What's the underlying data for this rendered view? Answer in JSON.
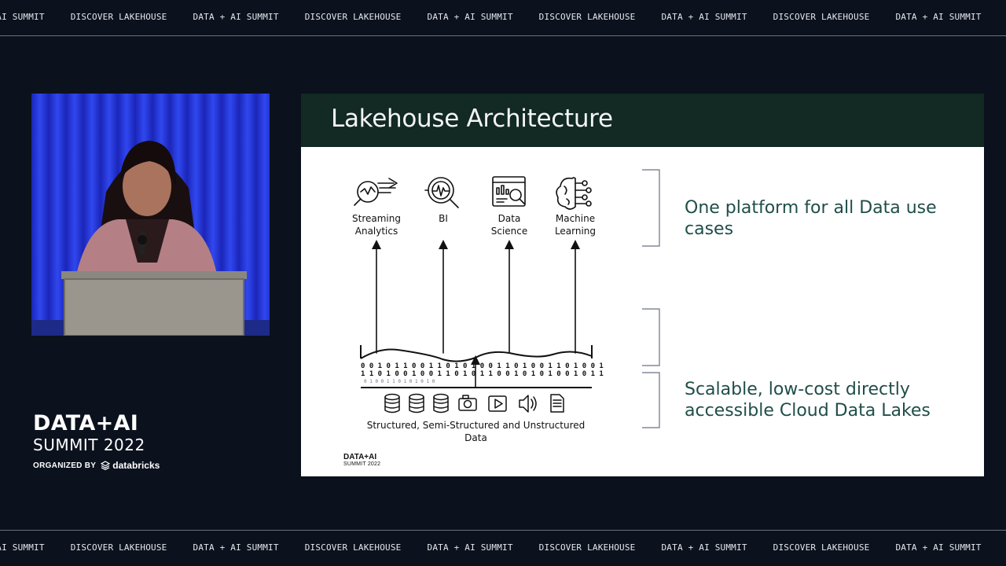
{
  "ticker": {
    "top_items": [
      "A + AI SUMMIT",
      "DISCOVER LAKEHOUSE",
      "DATA + AI SUMMIT",
      "DISCOVER LAKEHOUSE",
      "DATA + AI SUMMIT",
      "DISCOVER LAKEHOUSE",
      "DATA + AI SUMMIT",
      "DISCOVER LAKEHOUSE",
      "DATA + AI SUMMIT",
      "DISCOVER LAKEHOUSE"
    ],
    "bottom_items": [
      "A + AI SUMMIT",
      "DISCOVER LAKEHOUSE",
      "DATA + AI SUMMIT",
      "DISCOVER LAKEHOUSE",
      "DATA + AI SUMMIT",
      "DISCOVER LAKEHOUSE",
      "DATA + AI SUMMIT",
      "DISCOVER LAKEHOUSE",
      "DATA + AI SUMMIT",
      "DISCOVER LAKEHOUSE"
    ]
  },
  "event_logo": {
    "line1": "DATA+AI",
    "line2": "SUMMIT 2022",
    "organized_by": "ORGANIZED BY",
    "sponsor": "databricks"
  },
  "slide": {
    "title": "Lakehouse Architecture",
    "use_cases": [
      {
        "line1": "Streaming",
        "line2": "Analytics",
        "icon": "streaming-analytics-icon"
      },
      {
        "line1": "BI",
        "line2": "",
        "icon": "bi-magnifier-icon"
      },
      {
        "line1": "Data",
        "line2": "Science",
        "icon": "data-science-icon"
      },
      {
        "line1": "Machine",
        "line2": "Learning",
        "icon": "machine-learning-brain-icon"
      }
    ],
    "data_caption_line1": "Structured, Semi-Structured and Unstructured",
    "data_caption_line2": "Data",
    "data_icons": [
      "database-icon",
      "database-icon",
      "database-icon",
      "camera-icon",
      "video-icon",
      "audio-icon",
      "document-icon"
    ],
    "claim_top": "One platform for all Data use cases",
    "claim_bottom_line1": "Scalable, low-cost directly",
    "claim_bottom_line2": "accessible Cloud Data Lakes",
    "footer_logo_line1": "DATA+AI",
    "footer_logo_line2": "SUMMIT 2022"
  },
  "colors": {
    "page_background": "#0b111d",
    "slide_header": "#122924",
    "claim_text": "#1f4e49",
    "stage_backdrop": "#2031d6"
  }
}
